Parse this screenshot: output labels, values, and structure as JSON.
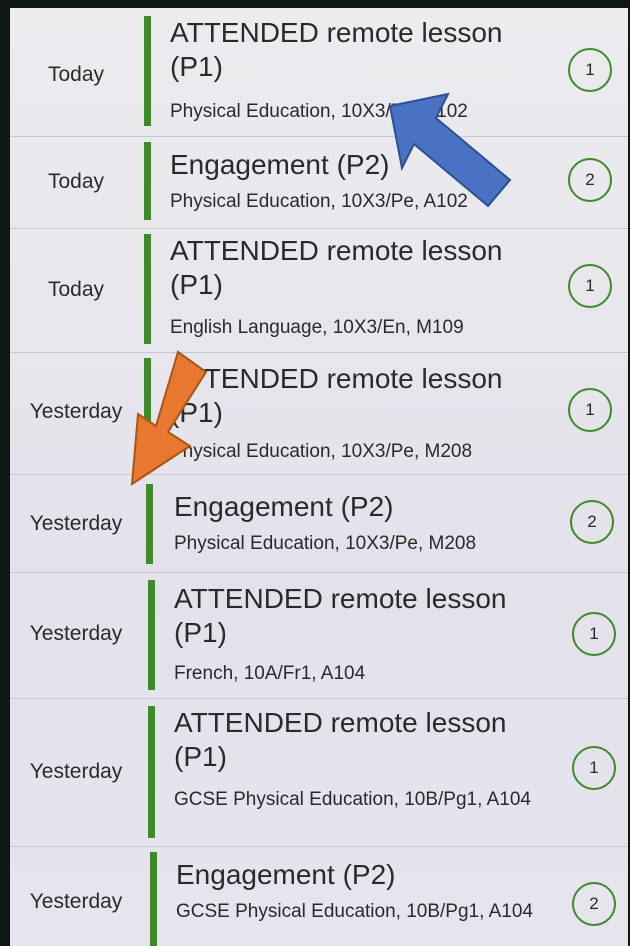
{
  "timetable": {
    "items": [
      {
        "day": "Today",
        "title": "ATTENDED remote lesson (P1)",
        "detail": "Physical Education, 10X3/Pe, A102",
        "points": "1"
      },
      {
        "day": "Today",
        "title": "Engagement (P2)",
        "detail": "Physical Education, 10X3/Pe, A102",
        "points": "2"
      },
      {
        "day": "Today",
        "title": "ATTENDED remote lesson (P1)",
        "detail": "English Language, 10X3/En, M109",
        "points": "1"
      },
      {
        "day": "Yesterday",
        "title": "ATTENDED remote lesson (P1)",
        "detail": "Physical Education, 10X3/Pe, M208",
        "points": "1"
      },
      {
        "day": "Yesterday",
        "title": "Engagement (P2)",
        "detail": "Physical Education, 10X3/Pe, M208",
        "points": "2"
      },
      {
        "day": "Yesterday",
        "title": "ATTENDED remote lesson (P1)",
        "detail": "French, 10A/Fr1, A104",
        "points": "1"
      },
      {
        "day": "Yesterday",
        "title": "ATTENDED remote lesson (P1)",
        "detail": "GCSE Physical Education, 10B/Pg1, A104",
        "points": "1"
      },
      {
        "day": "Yesterday",
        "title": "Engagement (P2)",
        "detail": "GCSE Physical Education, 10B/Pg1, A104",
        "points": "2"
      }
    ]
  },
  "annotations": {
    "blue_arrow_color": "#4a72c4",
    "orange_arrow_color": "#e8782f"
  },
  "colors": {
    "accent_green": "#3f8a2a"
  }
}
